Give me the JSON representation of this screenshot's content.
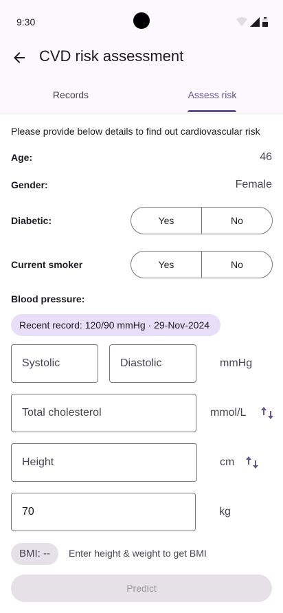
{
  "status_bar": {
    "time": "9:30"
  },
  "app_bar": {
    "title": "CVD risk assessment"
  },
  "tabs": [
    {
      "label": "Records"
    },
    {
      "label": "Assess risk"
    }
  ],
  "form": {
    "intro": "Please provide below details to find out cardiovascular risk",
    "age": {
      "label": "Age:",
      "value": "46"
    },
    "gender": {
      "label": "Gender:",
      "value": "Female"
    },
    "diabetic": {
      "label": "Diabetic:",
      "options": [
        "Yes",
        "No"
      ]
    },
    "smoker": {
      "label": "Current smoker",
      "options": [
        "Yes",
        "No"
      ]
    },
    "blood_pressure": {
      "label": "Blood pressure:",
      "recent_record": "Recent record: 120/90 mmHg · 29-Nov-2024",
      "systolic_placeholder": "Systolic",
      "diastolic_placeholder": "Diastolic",
      "unit": "mmHg"
    },
    "cholesterol": {
      "placeholder": "Total cholesterol",
      "unit": "mmol/L"
    },
    "height": {
      "placeholder": "Height",
      "unit": "cm"
    },
    "weight": {
      "value": "70",
      "unit": "kg"
    },
    "bmi": {
      "label": "BMI: --",
      "hint": "Enter height & weight to get BMI"
    },
    "predict_label": "Predict"
  },
  "colors": {
    "primary": "#65558f",
    "chip": "#e8def8",
    "outline": "#79747e"
  },
  "icons": [
    "back-arrow-icon",
    "wifi-icon",
    "signal-icon",
    "battery-icon",
    "swap-units-icon"
  ]
}
